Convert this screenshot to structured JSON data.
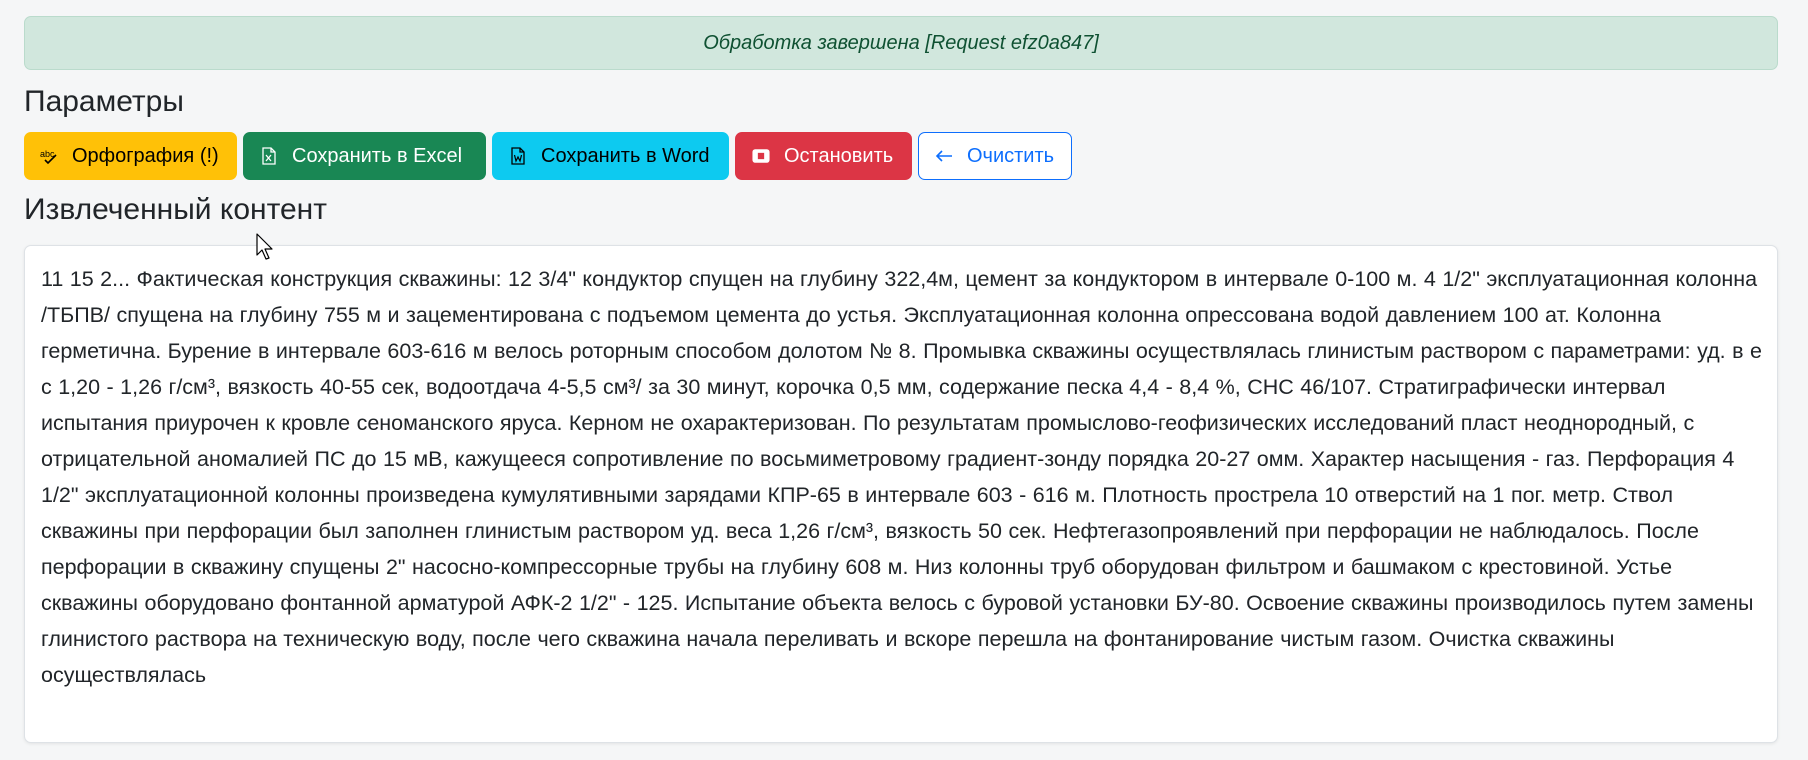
{
  "alert": {
    "text": "Обработка завершена [Request efz0a847]",
    "color": "#d1e7dd"
  },
  "sections": {
    "params_title": "Параметры",
    "content_title": "Извлеченный контент"
  },
  "toolbar": {
    "spell_label": "Орфография (!)",
    "spell_icon": "spellcheck-icon",
    "excel_label": "Сохранить в Excel",
    "excel_icon": "file-excel-icon",
    "word_label": "Сохранить в Word",
    "word_icon": "file-word-icon",
    "stop_label": "Остановить",
    "stop_icon": "stop-icon",
    "clear_label": "Очистить",
    "clear_icon": "arrow-left-icon"
  },
  "colors": {
    "warning": "#ffc107",
    "success": "#198754",
    "info": "#0dcaf0",
    "danger": "#dc3545",
    "primary": "#0d6efd"
  },
  "content": {
    "text": "11 15 2... Фактическая конструкция скважины: 12 3/4\" кондуктор спущен на глубину 322,4м, цемент за кондуктором в интервале 0-100 м. 4 1/2\" эксплуатационная колонна /ТБПВ/ спущена на глубину 755 м и зацементирована с подъемом цемента до устья. Эксплуатационная колонна опрессована водой давлением 100 ат. Колонна герметична. Бурение в интервале 603-616 м велось роторным способом долотом № 8. Промывка скважины осуществлялась глинистым раствором с параметрами: уд. в е с 1,20 - 1,26 г/см³, вязкость 40-55 сек, водоотдача 4-5,5 см³/ за 30 минут, корочка 0,5 мм, содержание песка 4,4 - 8,4 %, СНС 46/107. Стратиграфически интервал испытания приурочен к кровле сеноманского яруса. Керном не охарактеризован. По результатам промыслово-геофизических исследований пласт неоднородный, с отрицательной аномалией ПС до 15 мВ, кажущееся сопротивление по восьмиметровому градиент-зонду порядка 20-27 омм. Характер насыщения - газ. Перфорация 4 1/2\" эксплуатационной колонны произведена кумулятивными зарядами КПР-65 в интервале 603 - 616 м. Плотность прострела 10 отверстий на 1 пог. метр. Ствол скважины при перфорации был заполнен глинистым раствором уд. веса 1,26 г/см³, вязкость 50 сек. Нефтегазопроявлений при перфорации не наблюдалось. После перфорации в скважину спущены 2\" насосно-компрессорные трубы на глубину 608 м. Низ колонны труб оборудован фильтром и башмаком с крестовиной. Устье скважины оборудовано фонтанной арматурой АФК-2 1/2\" - 125. Испытание объекта велось с буровой установки БУ-80. Освоение скважины производилось путем замены глинистого раствора на техническую воду, после чего скважина начала переливать и вскоре перешла на фонтанирование чистым газом. Очистка скважины осуществлялась"
  }
}
